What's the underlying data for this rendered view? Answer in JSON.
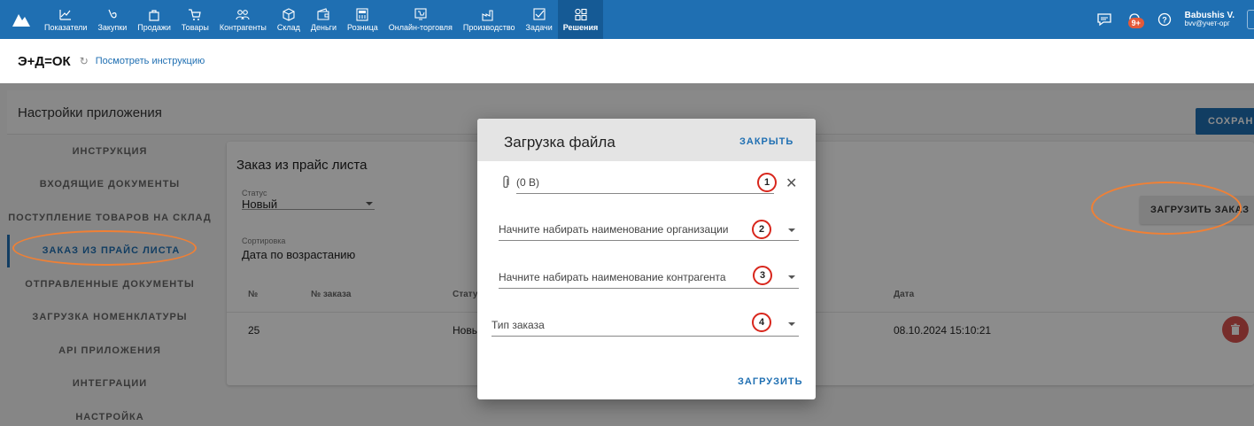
{
  "header": {
    "nav": [
      {
        "label": "Показатели",
        "icon": "chart-line-icon"
      },
      {
        "label": "Закупки",
        "icon": "purchase-icon"
      },
      {
        "label": "Продажи",
        "icon": "shopping-bag-icon"
      },
      {
        "label": "Товары",
        "icon": "cart-icon"
      },
      {
        "label": "Контрагенты",
        "icon": "people-icon"
      },
      {
        "label": "Склад",
        "icon": "box-icon"
      },
      {
        "label": "Деньги",
        "icon": "wallet-icon"
      },
      {
        "label": "Розница",
        "icon": "cash-register-icon"
      },
      {
        "label": "Онлайн-торговля",
        "icon": "online-store-icon"
      },
      {
        "label": "Производство",
        "icon": "factory-icon"
      },
      {
        "label": "Задачи",
        "icon": "checkbox-icon"
      },
      {
        "label": "Решения",
        "icon": "apps-grid-icon"
      }
    ],
    "active_nav": "Решения",
    "notifications_badge": "9+",
    "user": {
      "name": "Babushis V.",
      "email": "bvv@учет-орг"
    }
  },
  "subheader": {
    "app_title": "Э+Д=ОК",
    "instruction_link": "Посмотреть инструкцию"
  },
  "settings": {
    "title": "Настройки приложения",
    "save_label": "СОХРАНИТЬ",
    "menu": [
      "ИНСТРУКЦИЯ",
      "ВХОДЯЩИЕ ДОКУМЕНТЫ",
      "ПОСТУПЛЕНИЕ ТОВАРОВ НА СКЛАД",
      "ЗАКАЗ ИЗ ПРАЙС ЛИСТА",
      "ОТПРАВЛЕННЫЕ ДОКУМЕНТЫ",
      "ЗАГРУЗКА НОМЕНКЛАТУРЫ",
      "API ПРИЛОЖЕНИЯ",
      "ИНТЕГРАЦИИ",
      "НАСТРОЙКА"
    ],
    "active_menu": "ЗАКАЗ ИЗ ПРАЙС ЛИСТА"
  },
  "order_panel": {
    "title": "Заказ из прайс листа",
    "status_label": "Статус",
    "status_value": "Новый",
    "sort_label": "Сортировка",
    "sort_value": "Дата по возрастанию",
    "load_order_button": "ЗАГРУЗИТЬ ЗАКАЗ",
    "table": {
      "columns": [
        "№",
        "№ заказа",
        "Статус",
        "Дата"
      ],
      "rows": [
        [
          "25",
          "",
          "Новый",
          "08.10.2024 15:10:21"
        ]
      ]
    }
  },
  "modal": {
    "title": "Загрузка файла",
    "close_label": "ЗАКРЫТЬ",
    "file_value": "(0 B)",
    "org_placeholder": "Начните набирать наименование организации",
    "counterparty_placeholder": "Начните набирать наименование контрагента",
    "order_type_label": "Тип заказа",
    "upload_label": "ЗАГРУЗИТЬ",
    "step_numbers": [
      "1",
      "2",
      "3",
      "4"
    ]
  },
  "colors": {
    "primary": "#1f6fb2",
    "annotation_ellipse": "#f08035",
    "annotation_circle": "#d8261c",
    "delete": "#d9534f"
  }
}
